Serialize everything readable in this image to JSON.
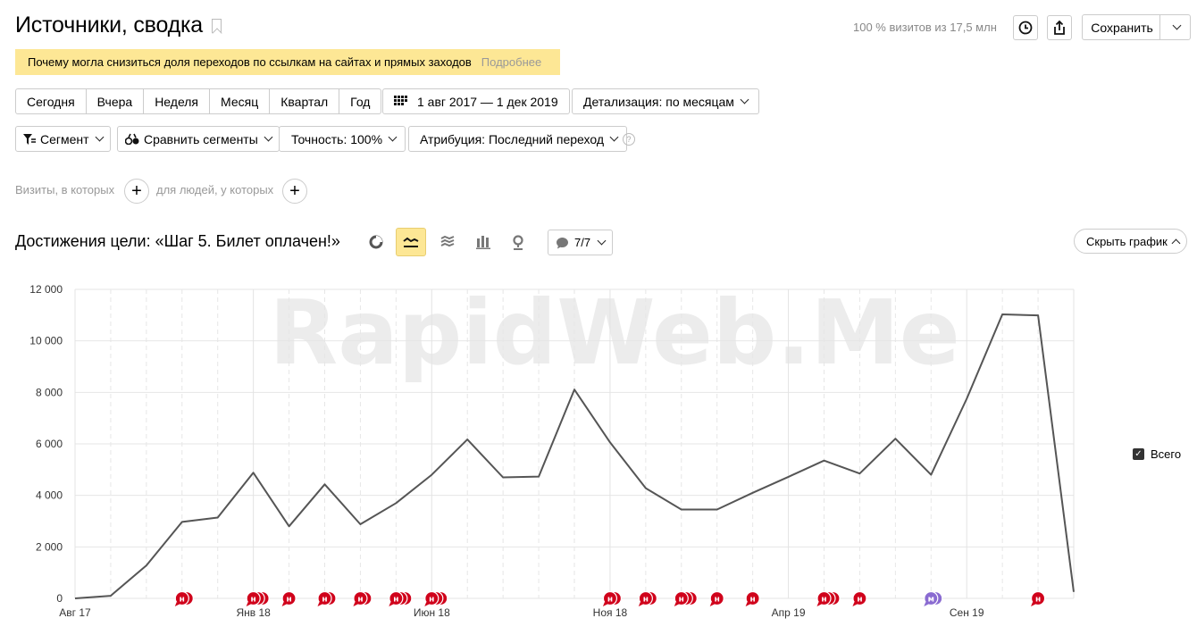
{
  "header": {
    "title": "Источники, сводка",
    "visits_info": "100 % визитов из 17,5 млн",
    "save_label": "Сохранить"
  },
  "banner": {
    "text": "Почему могла снизиться доля переходов по ссылкам на сайтах и прямых заходов",
    "link": "Подробнее"
  },
  "periods": [
    "Сегодня",
    "Вчера",
    "Неделя",
    "Месяц",
    "Квартал",
    "Год"
  ],
  "date_range": "1 авг 2017 — 1 дек 2019",
  "detail": "Детализация: по месяцам",
  "filters": {
    "segment": "Сегмент",
    "compare": "Сравнить сегменты",
    "accuracy": "Точность: 100%",
    "attribution": "Атрибуция: Последний переход",
    "hint": "?",
    "visits_where": "Визиты, в которых",
    "people_where": "для людей, у которых"
  },
  "goal_title": "Достижения цели: «Шаг 5. Билет оплачен!»",
  "notes_count": "7/7",
  "hide_chart": "Скрыть график",
  "legend_label": "Всего",
  "watermark": "RapidWeb.Me",
  "colors": {
    "line": "#555555",
    "note_red": "#d0021b",
    "note_purple": "#8a6bd1",
    "highlight": "#fde795"
  },
  "chart_data": {
    "type": "line",
    "x": [
      "2017-08",
      "2017-09",
      "2017-10",
      "2017-11",
      "2017-12",
      "2018-01",
      "2018-02",
      "2018-03",
      "2018-04",
      "2018-05",
      "2018-06",
      "2018-07",
      "2018-08",
      "2018-09",
      "2018-10",
      "2018-11",
      "2018-12",
      "2019-01",
      "2019-02",
      "2019-03",
      "2019-04",
      "2019-05",
      "2019-06",
      "2019-07",
      "2019-08",
      "2019-09",
      "2019-10",
      "2019-11",
      "2019-12"
    ],
    "series": [
      {
        "name": "Всего",
        "values": [
          0,
          100,
          1280,
          2970,
          3140,
          4880,
          2800,
          4430,
          2880,
          3700,
          4800,
          6170,
          4700,
          4730,
          8110,
          6060,
          4280,
          3450,
          3450,
          4100,
          4720,
          5350,
          4850,
          6200,
          4800,
          7750,
          11030,
          10990,
          250
        ]
      }
    ],
    "yticks": [
      "0",
      "2 000",
      "4 000",
      "6 000",
      "8 000",
      "10 000",
      "12 000"
    ],
    "ylim": [
      0,
      12000
    ],
    "xtick_labels": [
      "Авг 17",
      "Янв 18",
      "Июн 18",
      "Ноя 18",
      "Апр 19",
      "Сен 19"
    ],
    "xtick_index": [
      0,
      5,
      10,
      15,
      20,
      25
    ],
    "grid": true,
    "legend": "right",
    "notes": [
      {
        "i": 3,
        "n": 2,
        "color": "red"
      },
      {
        "i": 5,
        "n": 3,
        "color": "red"
      },
      {
        "i": 6,
        "n": 1,
        "color": "red"
      },
      {
        "i": 7,
        "n": 2,
        "color": "red"
      },
      {
        "i": 8,
        "n": 2,
        "color": "red"
      },
      {
        "i": 9,
        "n": 3,
        "color": "red"
      },
      {
        "i": 10,
        "n": 3,
        "color": "red"
      },
      {
        "i": 15,
        "n": 2,
        "color": "red"
      },
      {
        "i": 16,
        "n": 2,
        "color": "red"
      },
      {
        "i": 17,
        "n": 3,
        "color": "red"
      },
      {
        "i": 18,
        "n": 1,
        "color": "red"
      },
      {
        "i": 19,
        "n": 1,
        "color": "red"
      },
      {
        "i": 21,
        "n": 3,
        "color": "red"
      },
      {
        "i": 22,
        "n": 1,
        "color": "red"
      },
      {
        "i": 24,
        "n": 2,
        "color": "purple"
      },
      {
        "i": 27,
        "n": 1,
        "color": "red"
      }
    ]
  }
}
